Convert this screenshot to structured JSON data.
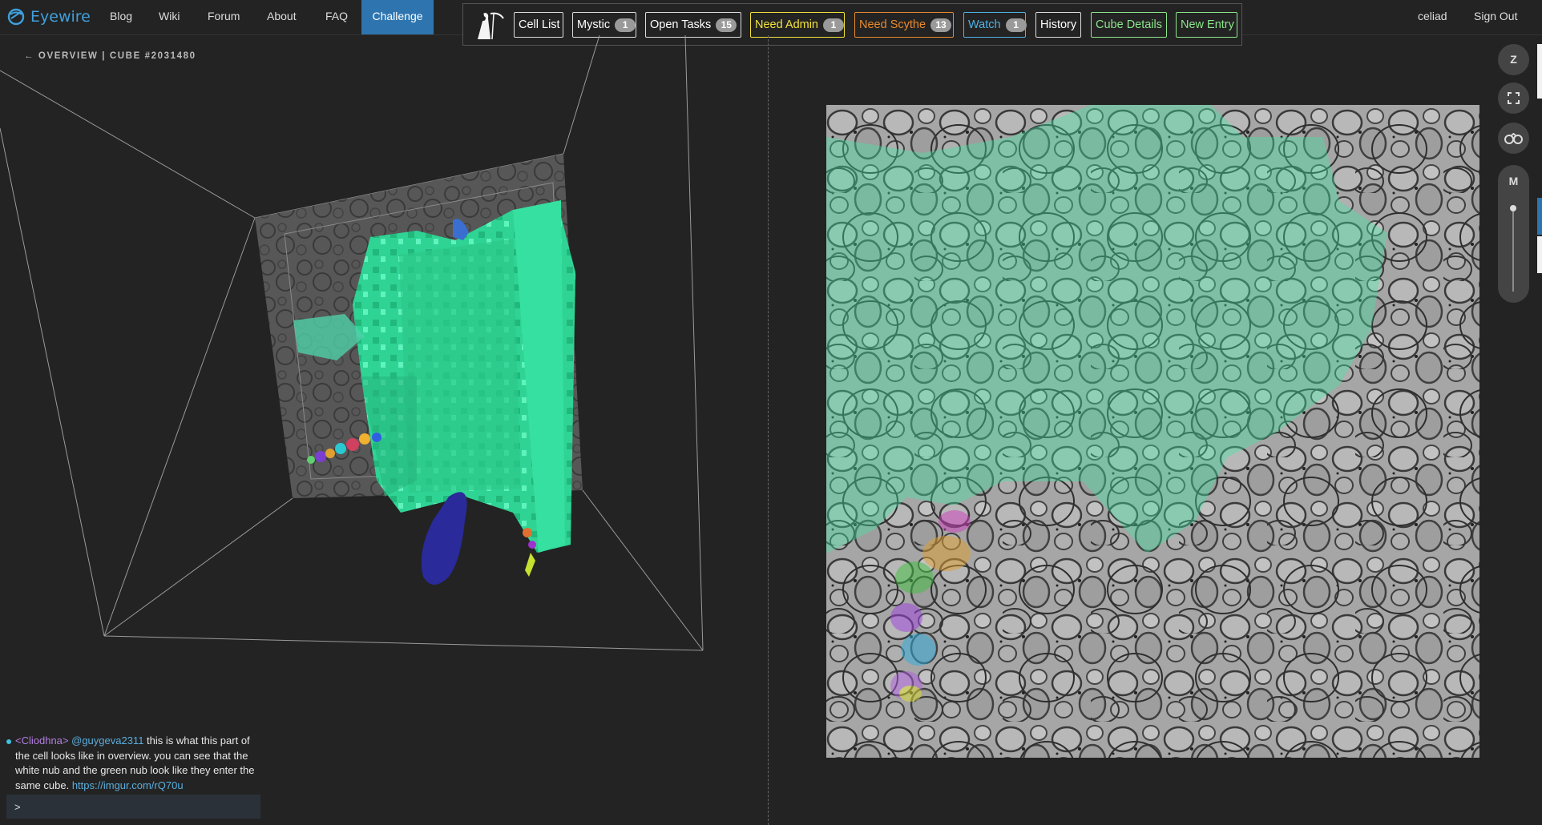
{
  "brand": {
    "name": "Eyewire",
    "icon": "eyewire-logo-icon"
  },
  "nav": {
    "items": [
      {
        "label": "Blog"
      },
      {
        "label": "Wiki"
      },
      {
        "label": "Forum"
      },
      {
        "label": "About"
      },
      {
        "label": "FAQ"
      },
      {
        "label": "Challenge",
        "active": true
      }
    ],
    "user": "celiad",
    "sign_out": "Sign Out"
  },
  "toolbar": {
    "icon": "grim-reaper-icon",
    "buttons": [
      {
        "label": "Cell List",
        "badge": null,
        "color": "#ffffff"
      },
      {
        "label": "Mystic",
        "badge": "1",
        "color": "#ffffff"
      },
      {
        "label": "Open Tasks",
        "badge": "15",
        "color": "#ffffff"
      },
      {
        "label": "Need Admin",
        "badge": "1",
        "color": "#f2e23a"
      },
      {
        "label": "Need Scythe",
        "badge": "13",
        "color": "#e8892e"
      },
      {
        "label": "Watch",
        "badge": "1",
        "color": "#4fb2e6"
      },
      {
        "label": "History",
        "badge": null,
        "color": "#ffffff"
      },
      {
        "label": "Cube Details",
        "badge": null,
        "color": "#8be58b"
      },
      {
        "label": "New Entry",
        "badge": null,
        "color": "#8be58b"
      }
    ]
  },
  "overview": {
    "breadcrumb": "← OVERVIEW | CUBE #2031480"
  },
  "chat": {
    "name": "<Cliodhna>",
    "mention": "@guygeva2311",
    "message": " this is what this part of the cell looks like in overview. you can see that the white nub and the green nub look like they enter the same cube. ",
    "link": "https://imgur.com/rQ70u",
    "input_prompt": ">"
  },
  "controls": {
    "zoom_label": "Z",
    "fullscreen_icon": "fullscreen-icon",
    "binoculars_icon": "binoculars-icon",
    "slider_label": "M",
    "slider_level": 1.0
  },
  "colors": {
    "segment_green": "#3ee8a4",
    "active_tab": "#2e75b0",
    "brand_blue": "#3fa0dc"
  }
}
